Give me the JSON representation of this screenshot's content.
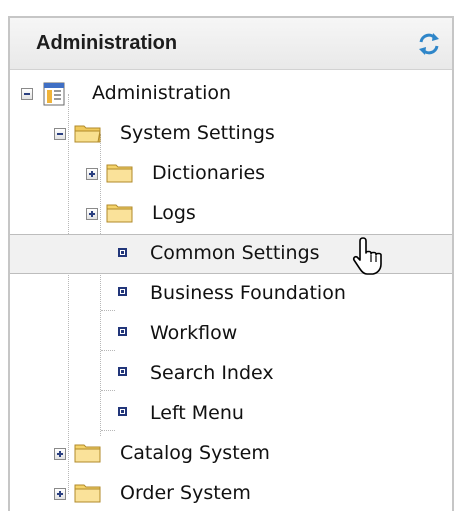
{
  "panel": {
    "title": "Administration",
    "refresh_icon": "refresh-icon"
  },
  "tree": {
    "root": {
      "label": "Administration",
      "expanded": true,
      "icon": "app-icon"
    },
    "system_settings": {
      "label": "System Settings",
      "expanded": true,
      "icon": "folder-open-icon"
    },
    "dictionaries": {
      "label": "Dictionaries",
      "expanded": false,
      "icon": "folder-icon"
    },
    "logs": {
      "label": "Logs",
      "expanded": false,
      "icon": "folder-icon"
    },
    "common_settings": {
      "label": "Common Settings",
      "selected": true
    },
    "business_foundation": {
      "label": "Business Foundation"
    },
    "workflow": {
      "label": "Workflow"
    },
    "search_index": {
      "label": "Search Index"
    },
    "left_menu": {
      "label": "Left Menu"
    },
    "catalog_system": {
      "label": "Catalog System",
      "expanded": false,
      "icon": "folder-icon"
    },
    "order_system": {
      "label": "Order System",
      "expanded": false,
      "icon": "folder-icon"
    }
  },
  "colors": {
    "folder": "#f5d36a",
    "expander_glyph": "#2a3f80",
    "selected_row": "#f1f1f1"
  }
}
